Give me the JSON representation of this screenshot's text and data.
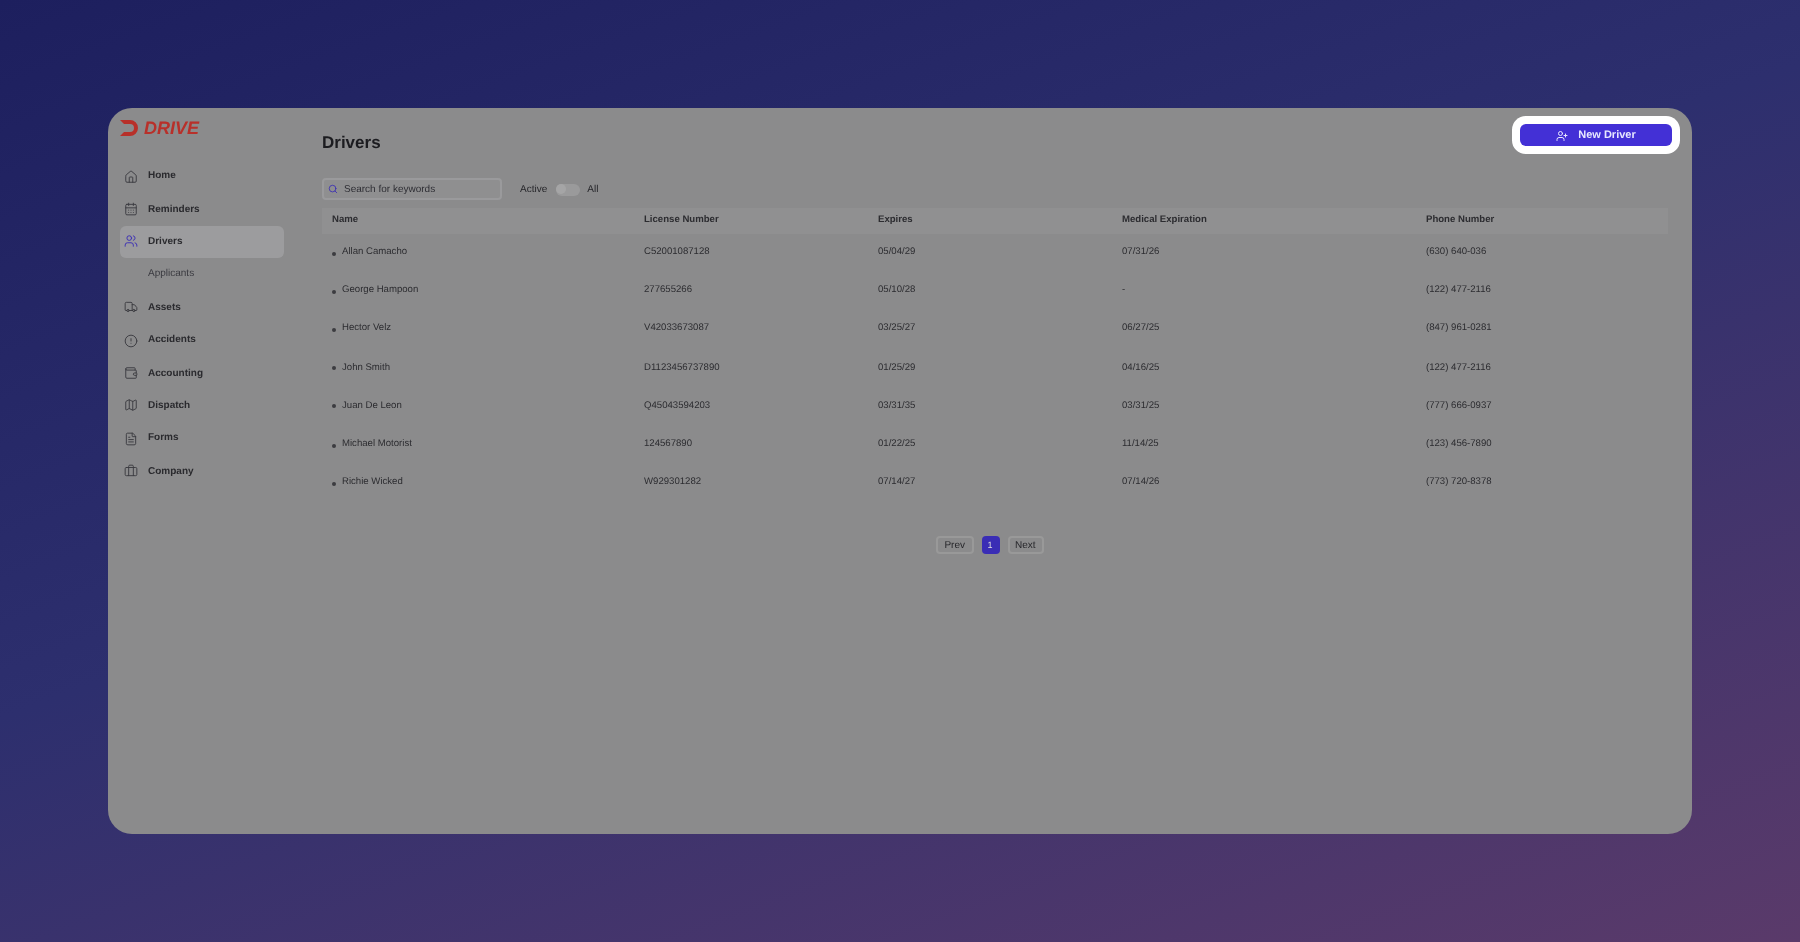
{
  "brand": {
    "name": "DRIVE"
  },
  "sidebar": {
    "items": [
      {
        "label": "Home",
        "kind": "main",
        "selected": false
      },
      {
        "label": "Reminders",
        "kind": "main",
        "selected": false
      },
      {
        "label": "Drivers",
        "kind": "main",
        "selected": true
      },
      {
        "label": "Applicants",
        "kind": "sub",
        "selected": false
      },
      {
        "label": "Assets",
        "kind": "main",
        "selected": false
      },
      {
        "label": "Accidents",
        "kind": "main",
        "selected": false
      },
      {
        "label": "Accounting",
        "kind": "main",
        "selected": false
      },
      {
        "label": "Dispatch",
        "kind": "main",
        "selected": false
      },
      {
        "label": "Forms",
        "kind": "main",
        "selected": false
      },
      {
        "label": "Company",
        "kind": "main",
        "selected": false
      }
    ]
  },
  "page": {
    "title": "Drivers",
    "new_button": "New Driver"
  },
  "search": {
    "placeholder": "Search for keywords"
  },
  "filter": {
    "left_label": "Active",
    "right_label": "All",
    "on": false
  },
  "table": {
    "columns": [
      "Name",
      "License Number",
      "Expires",
      "Medical Expiration",
      "Phone Number"
    ],
    "rows": [
      [
        "Allan Camacho",
        "C52001087128",
        "05/04/29",
        "07/31/26",
        "(630) 640-036"
      ],
      [
        "George Hampoon",
        "277655266",
        "05/10/28",
        "-",
        "(122) 477-2116"
      ],
      [
        "Hector Velz",
        "V42033673087",
        "03/25/27",
        "06/27/25",
        "(847) 961-0281"
      ],
      [
        "John Smith",
        "D1123456737890",
        "01/25/29",
        "04/16/25",
        "(122) 477-2116"
      ],
      [
        "Juan De Leon",
        "Q45043594203",
        "03/31/35",
        "03/31/25",
        "(777) 666-0937"
      ],
      [
        "Michael Motorist",
        "124567890",
        "01/22/25",
        "11/14/25",
        "(123) 456-7890"
      ],
      [
        "Richie Wicked",
        "W929301282",
        "07/14/27",
        "07/14/26",
        "(773) 720-8378"
      ]
    ]
  },
  "pagination": {
    "prev": "Prev",
    "next": "Next",
    "pages": [
      {
        "label": "1",
        "selected": true
      }
    ]
  }
}
